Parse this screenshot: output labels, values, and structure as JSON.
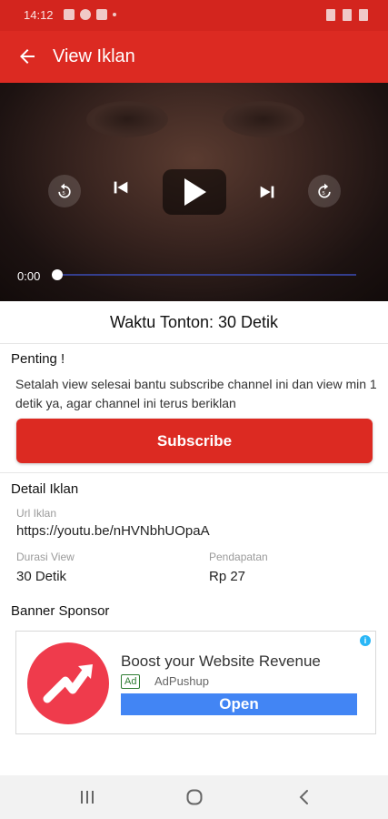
{
  "status_bar": {
    "time": "14:12"
  },
  "app_bar": {
    "title": "View Iklan"
  },
  "player": {
    "current_time": "0:00",
    "progress": 0
  },
  "watch_time": "Waktu Tonton: 30 Detik",
  "important": {
    "heading": "Penting !",
    "text": "Setalah view selesai bantu subscribe channel ini dan view min 1 detik ya, agar channel ini terus beriklan",
    "subscribe_label": "Subscribe"
  },
  "detail": {
    "heading": "Detail Iklan",
    "url_label": "Url Iklan",
    "url_value": "https://youtu.be/nHVNbhUOpaA",
    "duration_label": "Durasi View",
    "duration_value": "30 Detik",
    "income_label": "Pendapatan",
    "income_value": "Rp 27"
  },
  "banner": {
    "heading": "Banner Sponsor",
    "headline": "Boost your Website Revenue",
    "ad_badge": "Ad",
    "advertiser": "AdPushup",
    "cta": "Open",
    "info": "i"
  },
  "colors": {
    "primary": "#dc2a22",
    "status_bar": "#d3251e",
    "ad_button": "#4285f4"
  }
}
